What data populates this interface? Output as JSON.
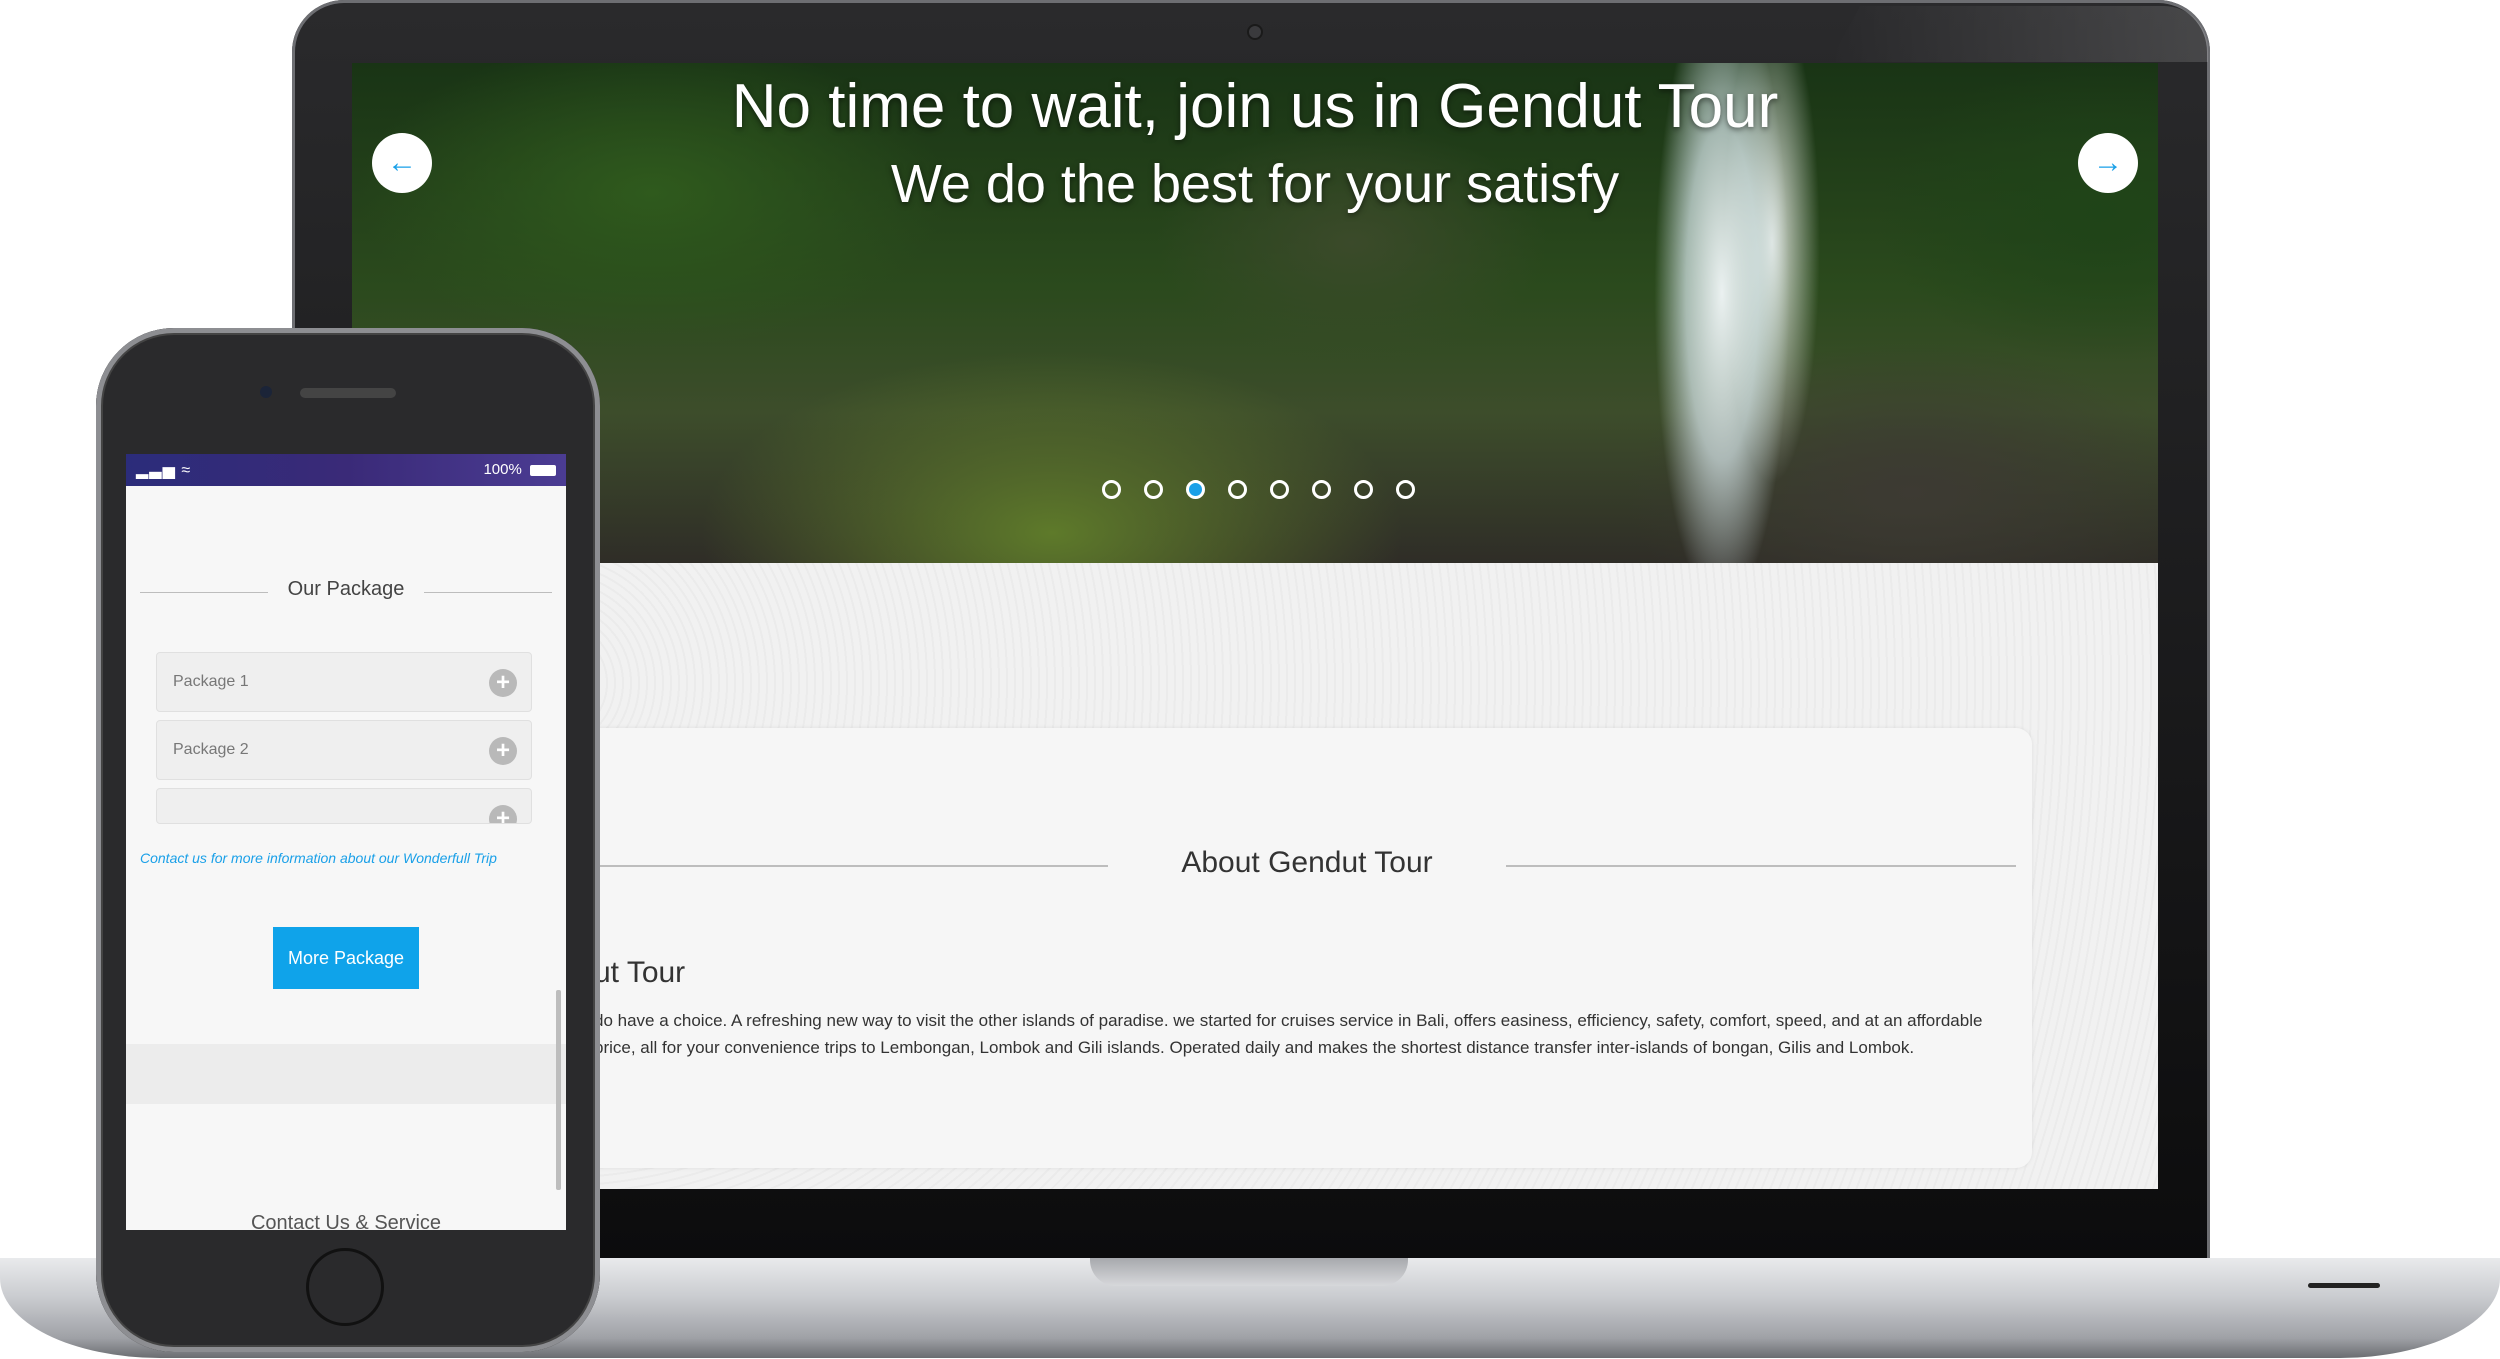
{
  "hero": {
    "title": "No time to wait, join us in Gendut Tour",
    "subtitle": "We do the best for your satisfy",
    "prev_icon": "arrow-left-icon",
    "next_icon": "arrow-right-icon",
    "slide_count": 8,
    "active_slide": 3
  },
  "about": {
    "heading": "About Gendut Tour",
    "subheading": "ut Tour",
    "text": "do have a choice. A refreshing new way to visit the other islands of paradise. we started for cruises service in Bali, offers easiness, efficiency, safety, comfort, speed, and at an affordable price, all for your convenience trips to Lembongan, Lombok and Gili islands. Operated daily and makes the shortest distance transfer inter-islands of bongan, Gilis and Lombok."
  },
  "phone": {
    "status_battery": "100%",
    "package_title": "Our Package",
    "packages": [
      "Package 1",
      "Package 2",
      ""
    ],
    "contact_link": "Contact us for more information about our Wonderfull Trip",
    "more_button": "More Package",
    "contact_title": "Contact Us & Service"
  },
  "colors": {
    "accent": "#0fa3ea"
  }
}
